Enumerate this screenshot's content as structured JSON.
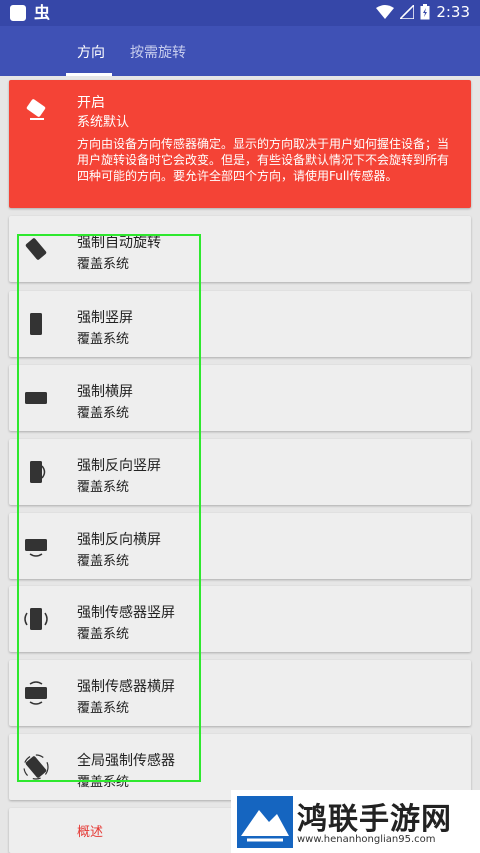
{
  "status_bar": {
    "time": "2:33",
    "bug_glyph": "虫"
  },
  "tabs": [
    {
      "label": "方向"
    },
    {
      "label": "按需旋转"
    }
  ],
  "rows": [
    {
      "icon": "eraser-icon",
      "title": "开启",
      "subtitle": "系统默认",
      "description": "方向由设备方向传感器确定。显示的方向取决于用户如何握住设备；当用户旋转设备时它会改变。但是，有些设备默认情况下不会旋转到所有四种可能的方向。要允许全部四个方向，请使用Full传感器。"
    },
    {
      "icon": "auto-rotate-icon",
      "title": "强制自动旋转",
      "subtitle": "覆盖系统"
    },
    {
      "icon": "portrait-icon",
      "title": "强制竖屏",
      "subtitle": "覆盖系统"
    },
    {
      "icon": "landscape-icon",
      "title": "强制横屏",
      "subtitle": "覆盖系统"
    },
    {
      "icon": "reverse-portrait-icon",
      "title": "强制反向竖屏",
      "subtitle": "覆盖系统"
    },
    {
      "icon": "reverse-landscape-icon",
      "title": "强制反向横屏",
      "subtitle": "覆盖系统"
    },
    {
      "icon": "sensor-portrait-icon",
      "title": "强制传感器竖屏",
      "subtitle": "覆盖系统"
    },
    {
      "icon": "sensor-landscape-icon",
      "title": "强制传感器横屏",
      "subtitle": "覆盖系统"
    },
    {
      "icon": "full-sensor-icon",
      "title": "全局强制传感器",
      "subtitle": "覆盖系统"
    }
  ],
  "overview": {
    "label": "概述"
  },
  "watermark": {
    "text": "鸿联手游网",
    "url": "www.henanhonglian95.com"
  },
  "colors": {
    "primary": "#3f51b5",
    "status_bar": "#3647a8",
    "active_row": "#f44336",
    "highlight": "#2ee82e"
  }
}
